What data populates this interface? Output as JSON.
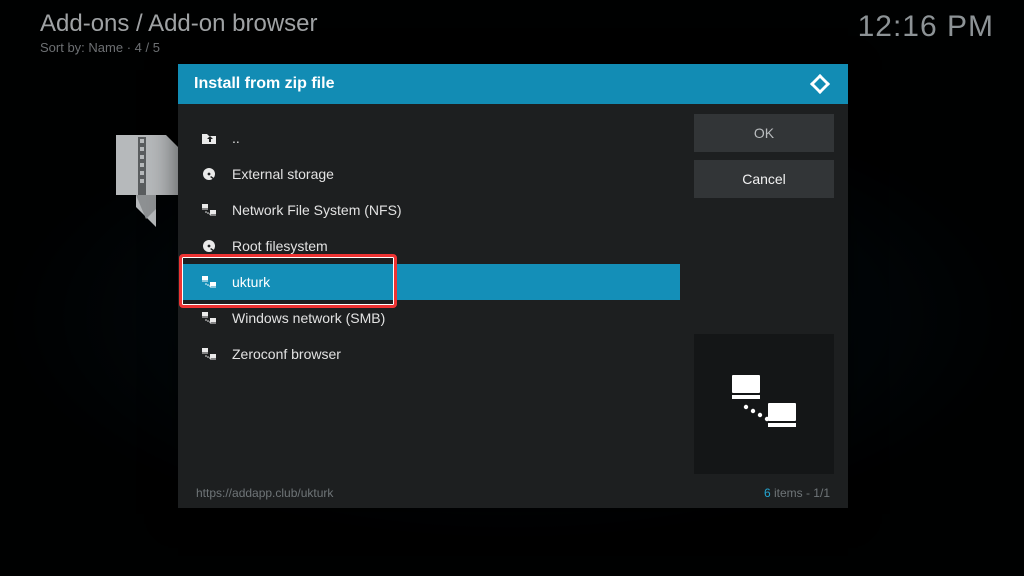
{
  "header": {
    "breadcrumb": "Add-ons / Add-on browser",
    "sort_line": "Sort by: Name  ·  4 / 5",
    "clock": "12:16 PM"
  },
  "dialog": {
    "title": "Install from zip file",
    "items": [
      {
        "label": "..",
        "icon": "folder-up"
      },
      {
        "label": "External storage",
        "icon": "hdd"
      },
      {
        "label": "Network File System (NFS)",
        "icon": "network"
      },
      {
        "label": "Root filesystem",
        "icon": "hdd"
      },
      {
        "label": "ukturk",
        "icon": "network",
        "selected": true
      },
      {
        "label": "Windows network (SMB)",
        "icon": "network"
      },
      {
        "label": "Zeroconf browser",
        "icon": "network"
      }
    ],
    "buttons": {
      "ok": "OK",
      "cancel": "Cancel"
    },
    "footer_path": "https://addapp.club/ukturk",
    "footer_count_n": "6",
    "footer_count_rest": " items - 1/1"
  }
}
